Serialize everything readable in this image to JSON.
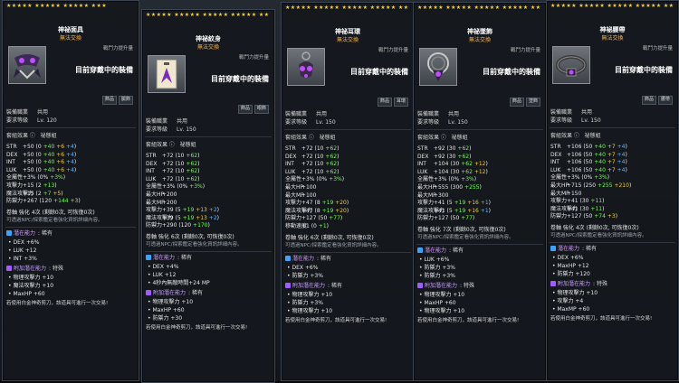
{
  "header": {
    "trade_label": "無法交換",
    "equipped_label": "目前穿戴中的裝備",
    "ce_label": "戰鬥力提升量"
  },
  "labels": {
    "req_job": "裝備職業",
    "req_level": "要求等級",
    "job_value": "共用",
    "set_effect": "套組效果",
    "potential": "潛在能力",
    "bonus_potential": "附加潛在能力",
    "scroll_note": "可透過NPC/探索鑑定看強化資訊詳細內容。",
    "footer_note": "若使用白金神奇剪刀，該道具可進行一次交易!"
  },
  "items": [
    {
      "name": "神祕面具",
      "stars_gold": 18,
      "stars_total": 18,
      "icon": "mask-icon",
      "level": "Lv. 120",
      "tags": [
        "飾品",
        "臉飾"
      ],
      "set_name": "祕態組",
      "stats": [
        [
          "STR",
          "+50 (0 +40 +6 +4)"
        ],
        [
          "DEX",
          "+50 (0 +40 +6 +4)"
        ],
        [
          "INT",
          "+50 (0 +40 +6 +4)"
        ],
        [
          "LUK",
          "+50 (0 +40 +6 +4)"
        ],
        [
          "全屬性",
          "+3% (0% +3%)"
        ],
        [
          "攻擊力",
          "+15 (2 +13)"
        ],
        [
          "魔法攻擊力",
          "+15 (2 +7 +5)"
        ],
        [
          "防禦力",
          "+267 (120 +144 +3)"
        ]
      ],
      "scroll_line": "卷軸 強化 4次 (剩餘0次, 可恢復0次)",
      "potential_tier": "稀有",
      "potential_lines": [
        "DEX +6%",
        "LUK +12",
        "INT +3%"
      ],
      "bonus_tier": "特殊",
      "bonus_lines": [
        "物理攻擊力 +10",
        "魔法攻擊力 +10",
        "MaxHP +60"
      ]
    },
    {
      "name": "神祕紋身",
      "stars_gold": 22,
      "stars_total": 22,
      "icon": "tattoo-icon",
      "level": "Lv. 150",
      "tags": [
        "飾品",
        "眼飾"
      ],
      "set_name": "祕態組",
      "stats": [
        [
          "STR",
          "+72 (10 +62)"
        ],
        [
          "DEX",
          "+72 (10 +62)"
        ],
        [
          "INT",
          "+72 (10 +62)"
        ],
        [
          "LUK",
          "+72 (10 +62)"
        ],
        [
          "全屬性",
          "+3% (0% +3%)"
        ],
        [
          "最大HP",
          "+200"
        ],
        [
          "最大MP",
          "+200"
        ],
        [
          "攻擊力",
          "+39 (5 +19 +13 +2)"
        ],
        [
          "魔法攻擊力",
          "+39 (5 +19 +13 +2)"
        ],
        [
          "防禦力",
          "+290 (120 +170)"
        ]
      ],
      "scroll_line": "卷軸 強化 6次 (剩餘0次, 可恢復0次)",
      "potential_tier": "稀有",
      "potential_lines": [
        "DEX +4%",
        "LUK +12",
        "4秒內無敵時間+24 MP"
      ],
      "bonus_tier": "稀有",
      "bonus_lines": [
        "物理攻擊力 +10",
        "MaxHP +60",
        "防禦力 +30"
      ]
    },
    {
      "name": "神祕耳環",
      "stars_gold": 22,
      "stars_total": 22,
      "icon": "earring-icon",
      "level": "Lv. 150",
      "tags": [
        "飾品",
        "耳環"
      ],
      "set_name": "祕態組",
      "stats": [
        [
          "STR",
          "+72 (10 +62)"
        ],
        [
          "DEX",
          "+72 (10 +62)"
        ],
        [
          "INT",
          "+72 (10 +62)"
        ],
        [
          "LUK",
          "+72 (10 +62)"
        ],
        [
          "全屬性",
          "+3% (0% +3%)"
        ],
        [
          "最大HP",
          "+100"
        ],
        [
          "最大MP",
          "+100"
        ],
        [
          "攻擊力",
          "+47 (8 +19 +20)"
        ],
        [
          "魔法攻擊力",
          "+47 (8 +19 +20)"
        ],
        [
          "防禦力",
          "+127 (50 +77)"
        ],
        [
          "移動速度",
          "+1 (0 +1)"
        ]
      ],
      "scroll_line": "卷軸 強化 6次 (剩餘0次, 可恢復0次)",
      "potential_tier": "稀有",
      "potential_lines": [
        "DEX +6%",
        "防禦力 +3%"
      ],
      "bonus_tier": "稀有",
      "bonus_lines": [
        "物理攻擊力 +10",
        "防禦力 +3%",
        "物理攻擊力 +10"
      ]
    },
    {
      "name": "神祕墜飾",
      "stars_gold": 22,
      "stars_total": 22,
      "icon": "pendant-icon",
      "level": "Lv. 150",
      "tags": [
        "飾品",
        "墜飾"
      ],
      "set_name": "祕態組",
      "stats": [
        [
          "STR",
          "+92 (30 +62)"
        ],
        [
          "DEX",
          "+92 (30 +62)"
        ],
        [
          "INT",
          "+104 (30 +62 +12)"
        ],
        [
          "LUK",
          "+104 (30 +62 +12)"
        ],
        [
          "全屬性",
          "+3% (0% +3%)"
        ],
        [
          "最大HP",
          "+555 (300 +255)"
        ],
        [
          "最大MP",
          "+300"
        ],
        [
          "攻擊力",
          "+41 (5 +19 +16 +1)"
        ],
        [
          "魔法攻擊力",
          "+41 (5 +19 +16 +1)"
        ],
        [
          "防禦力",
          "+127 (50 +77)"
        ]
      ],
      "scroll_line": "卷軸 強化 7次 (剩餘0次, 可恢復0次)",
      "potential_tier": "稀有",
      "potential_lines": [
        "LUK +6%",
        "防禦力 +3%",
        "防禦力 +3%"
      ],
      "bonus_tier": "特殊",
      "bonus_lines": [
        "物理攻擊力 +10",
        "MaxHP +60",
        "物理攻擊力 +10"
      ]
    },
    {
      "name": "神祕腰帶",
      "stars_gold": 22,
      "stars_total": 22,
      "icon": "belt-icon",
      "level": "Lv. 150",
      "tags": [
        "飾品",
        "腰帶"
      ],
      "set_name": "祕態組",
      "stats": [
        [
          "STR",
          "+106 (50 +40 +7 +4)"
        ],
        [
          "DEX",
          "+106 (50 +40 +7 +4)"
        ],
        [
          "INT",
          "+106 (50 +40 +7 +4)"
        ],
        [
          "LUK",
          "+106 (50 +40 +7 +4)"
        ],
        [
          "全屬性",
          "+3% (0% +3%)"
        ],
        [
          "最大HP",
          "+715 (250 +255 +210)"
        ],
        [
          "最大MP",
          "+150"
        ],
        [
          "攻擊力",
          "+41 (30 +11)"
        ],
        [
          "魔法攻擊力",
          "+41 (30 +11)"
        ],
        [
          "防禦力",
          "+127 (50 +74 +3)"
        ]
      ],
      "scroll_line": "卷軸 強化 4次 (剩餘0次, 可恢復0次)",
      "potential_tier": "稀有",
      "potential_lines": [
        "DEX +6%",
        "MaxHP +12",
        "防禦力 +120"
      ],
      "bonus_tier": "特殊",
      "bonus_lines": [
        "物理攻擊力 +10",
        "攻擊力 +4",
        "MaxMP +60"
      ]
    }
  ]
}
